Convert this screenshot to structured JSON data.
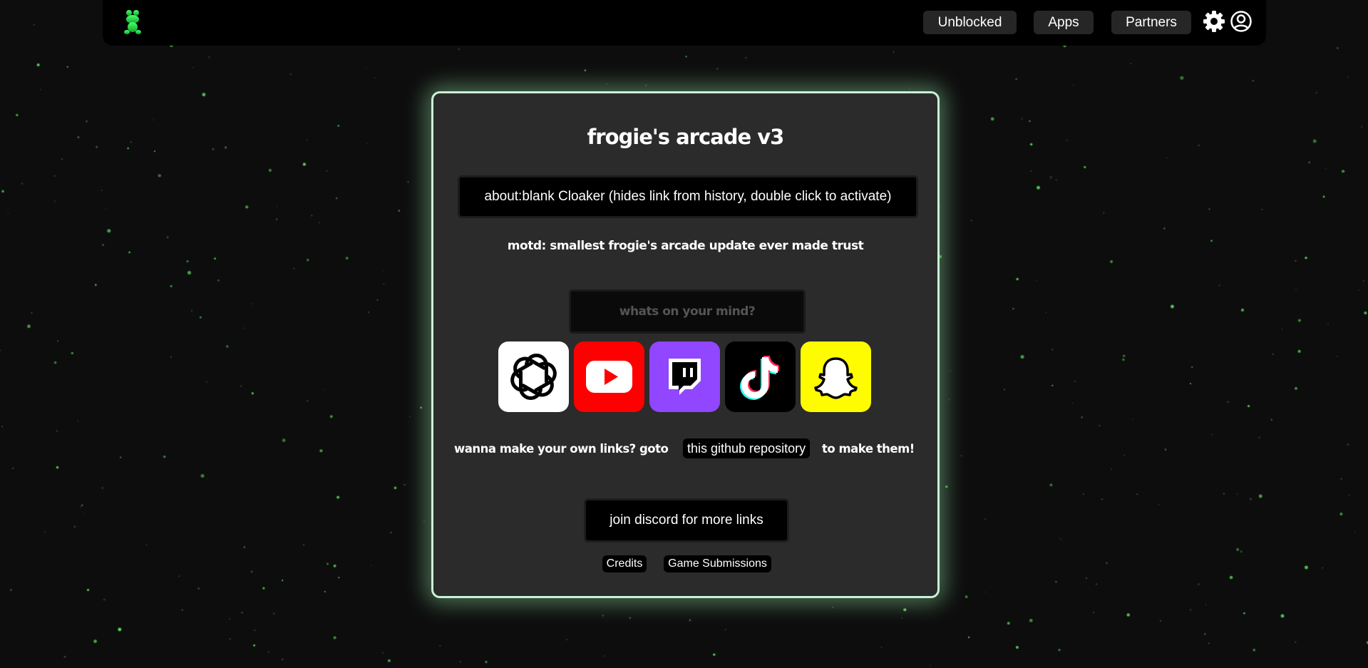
{
  "nav": {
    "logo": "frog-logo-icon",
    "items": [
      {
        "label": "Unblocked"
      },
      {
        "label": "Apps"
      },
      {
        "label": "Partners"
      }
    ],
    "settings_icon": "gear-icon",
    "account_icon": "user-circle-icon"
  },
  "card": {
    "title": "frogie's arcade v3",
    "cloaker_label": "about:blank Cloaker (hides link from history, double click to activate)",
    "motd": "motd: smallest frogie's arcade update ever made trust",
    "input_placeholder": "whats on your mind?",
    "apps": [
      {
        "name": "chatgpt",
        "icon": "openai-icon",
        "bg": "#ffffff"
      },
      {
        "name": "youtube",
        "icon": "youtube-icon",
        "bg": "#ff0000"
      },
      {
        "name": "twitch",
        "icon": "twitch-icon",
        "bg": "#9146ff"
      },
      {
        "name": "tiktok",
        "icon": "tiktok-icon",
        "bg": "#000000"
      },
      {
        "name": "snapchat",
        "icon": "snapchat-icon",
        "bg": "#fffc00"
      }
    ],
    "links_prefix": "wanna make your own links? goto",
    "links_button": "this github repository",
    "links_suffix": "to make them!",
    "discord_label": "join discord for more links",
    "credits_label": "Credits",
    "submissions_label": "Game Submissions"
  },
  "colors": {
    "background": "#0d0d0d",
    "card": "#2b2b2b",
    "card_glow": "#c9f2d4",
    "star": "#4caf50"
  }
}
